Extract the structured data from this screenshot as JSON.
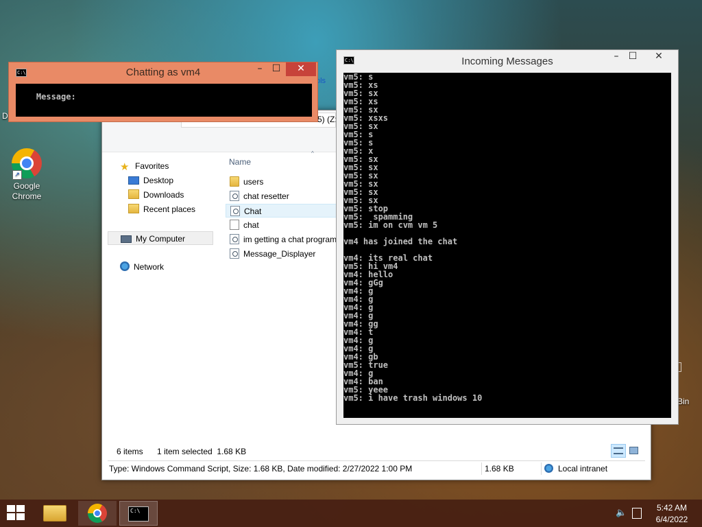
{
  "desktop": {
    "chrome_label": "Google Chrome",
    "left_partial": "D",
    "right_partial": "Bin"
  },
  "explorer": {
    "ribbon_partial": "ols",
    "address_partial": "5) (Z:",
    "nav": {
      "favorites": "Favorites",
      "desktop": "Desktop",
      "downloads": "Downloads",
      "recent": "Recent places",
      "my_computer": "My Computer",
      "network": "Network"
    },
    "column_header": "Name",
    "files": [
      {
        "name": "users",
        "type": "folder"
      },
      {
        "name": "chat resetter",
        "type": "script"
      },
      {
        "name": "Chat",
        "type": "script",
        "selected": true
      },
      {
        "name": "chat",
        "type": "text"
      },
      {
        "name": "im getting a chat program",
        "type": "script"
      },
      {
        "name": "Message_Displayer",
        "type": "script"
      }
    ],
    "status": {
      "items": "6 items",
      "selected": "1 item selected  1.68 KB"
    },
    "details": {
      "type": "Type: Windows Command Script, Size: 1.68 KB, Date modified: 2/27/2022 1:00 PM",
      "size": "1.68 KB",
      "zone": "Local intranet"
    }
  },
  "chat_window": {
    "title": "Chatting as vm4",
    "badge": "C:\\",
    "prompt": "Message:"
  },
  "incoming_window": {
    "title": "Incoming Messages",
    "badge": "C:\\",
    "lines": [
      "vm5: s",
      "vm5: xs",
      "vm5: sx",
      "vm5: xs",
      "vm5: sx",
      "vm5: xsxs",
      "vm5: sx",
      "vm5: s",
      "vm5: s",
      "vm5: x",
      "vm5: sx",
      "vm5: sx",
      "vm5: sx",
      "vm5: sx",
      "vm5: sx",
      "vm5: sx",
      "vm5: stop",
      "vm5:  spamming",
      "vm5: im on cvm vm 5",
      "",
      "vm4 has joined the chat",
      "",
      "vm4: its real chat",
      "vm5: hi vm4",
      "vm4: hello",
      "vm4: gGg",
      "vm4: g",
      "vm4: g",
      "vm4: g",
      "vm4: g",
      "vm4: gg",
      "vm4: t",
      "vm4: g",
      "vm4: g",
      "vm4: gb",
      "vm5: true",
      "vm4: g",
      "vm4: ban",
      "vm5: yeee",
      "vm5: i have trash windows 10"
    ]
  },
  "taskbar": {
    "time": "5:42 AM",
    "date": "6/4/2022",
    "cmd_badge": "C:\\"
  }
}
